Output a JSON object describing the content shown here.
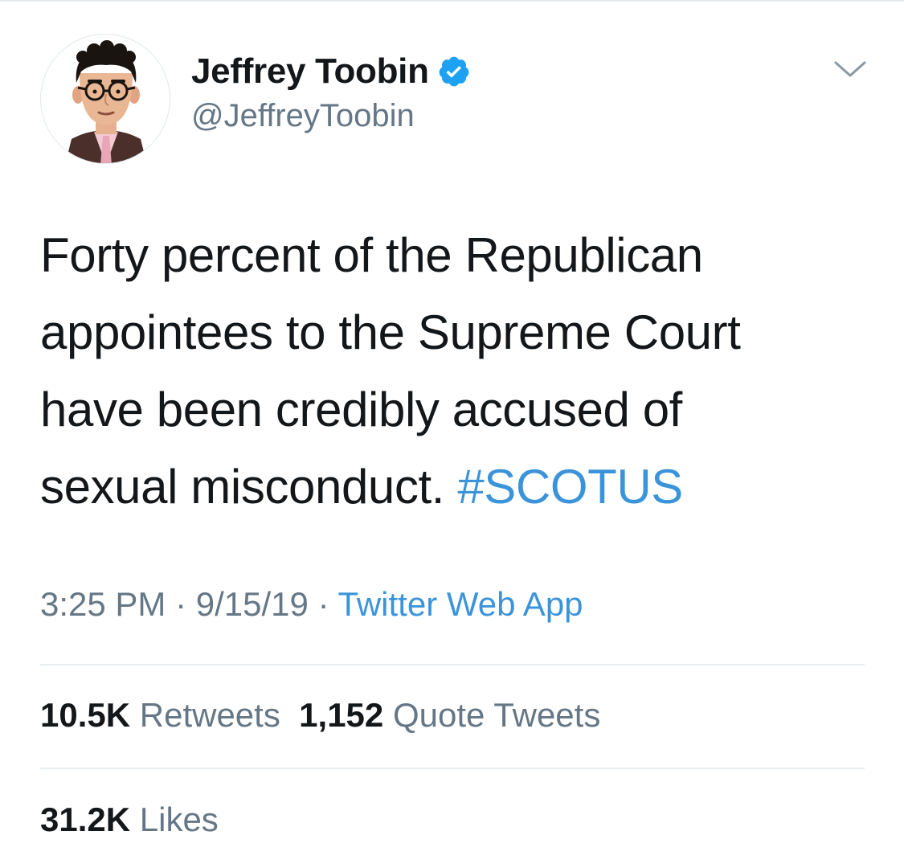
{
  "author": {
    "display_name": "Jeffrey Toobin",
    "handle": "@JeffreyToobin",
    "verified_icon": "verified-badge-icon",
    "avatar": "cartoon-portrait-avatar"
  },
  "tweet": {
    "text_lines": [
      "Forty percent of the Republican",
      "appointees to the Supreme Court",
      "have been credibly accused of",
      "sexual misconduct."
    ],
    "hashtag": "#SCOTUS"
  },
  "meta": {
    "time": "3:25 PM",
    "sep1": "·",
    "date": "9/15/19",
    "sep2": "·",
    "source": "Twitter Web App"
  },
  "stats": {
    "retweets_count": "10.5K",
    "retweets_label": "Retweets",
    "quotes_count": "1,152",
    "quotes_label": "Quote Tweets",
    "likes_count": "31.2K",
    "likes_label": "Likes"
  },
  "colors": {
    "link": "#3b94d9",
    "muted": "#657786",
    "text": "#14171a",
    "verified": "#1da1f2",
    "divider": "#e6ecf0"
  }
}
